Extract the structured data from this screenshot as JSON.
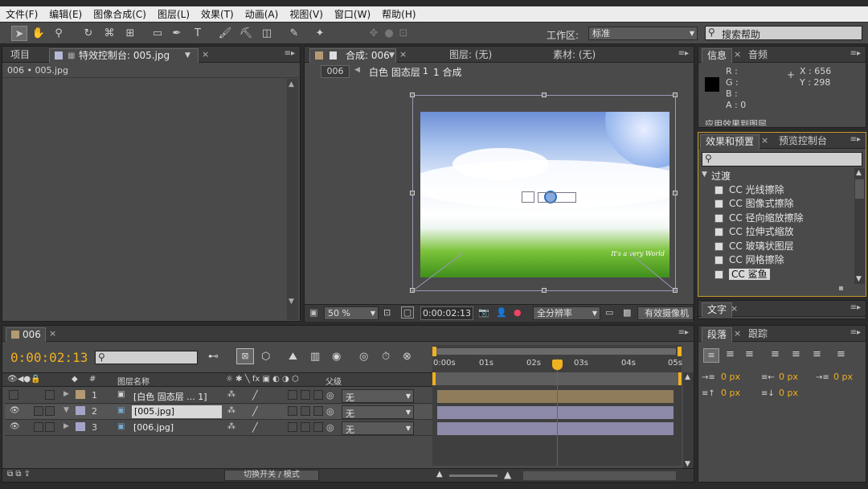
{
  "menu": [
    "文件(F)",
    "编辑(E)",
    "图像合成(C)",
    "图层(L)",
    "效果(T)",
    "动画(A)",
    "视图(V)",
    "窗口(W)",
    "帮助(H)"
  ],
  "toolbar": {
    "workspace_label": "工作区:",
    "workspace_value": "标准",
    "search_placeholder": "搜索帮助"
  },
  "project": {
    "tab_project": "项目",
    "tab_effects": "特效控制台: 005.jpg",
    "header": "006 • 005.jpg"
  },
  "comp": {
    "tab_comp": "合成: 006",
    "tab_layer": "图层: (无)",
    "tab_footage": "素材: (无)",
    "comp_name": "006",
    "breadcrumb_white": "白色 固态层",
    "breadcrumb_1": "1 合成",
    "breadcrumb_2": "1",
    "zoom": "50 %",
    "timecode": "0:00:02:13",
    "resolution": "全分辨率",
    "camera": "有效摄像机",
    "watermark": "It's a very World"
  },
  "info": {
    "tab_info": "信息",
    "tab_audio": "音频",
    "r": "R :",
    "g": "G :",
    "b": "B :",
    "a": "A : 0",
    "x": "X : 656",
    "y": "Y : 298",
    "clip": "应用效果到图层"
  },
  "effects": {
    "tab_effects": "效果和预置",
    "tab_preview": "预览控制台",
    "category": "过渡",
    "items": [
      "CC 光线擦除",
      "CC 图像式擦除",
      "CC 径向缩放擦除",
      "CC 拉伸式缩放",
      "CC 玻璃状图层",
      "CC 网格擦除",
      "CC 鲨鱼"
    ]
  },
  "text": {
    "tab": "文字"
  },
  "paragraph": {
    "tab_para": "段落",
    "tab_track": "跟踪",
    "v1": "0 px",
    "v2": "0 px",
    "v3": "0 px",
    "v4": "0 px",
    "v5": "0 px"
  },
  "timeline": {
    "tab": "006",
    "timecode": "0:00:02:13",
    "col_num": "#",
    "col_name": "图层名称",
    "col_parent": "父级",
    "ruler": [
      "0:00s",
      "01s",
      "02s",
      "03s",
      "04s",
      "05s"
    ],
    "toggle_label": "切换开关 / 模式",
    "layers": [
      {
        "num": "1",
        "name": "[白色 固态层 ... 1]",
        "parent": "无",
        "color": "#b49a72"
      },
      {
        "num": "2",
        "name": "[005.jpg]",
        "parent": "无",
        "color": "#a5a4c8"
      },
      {
        "num": "3",
        "name": "[006.jpg]",
        "parent": "无",
        "color": "#a5a4c8"
      }
    ]
  },
  "colors": {
    "accent": "#f0b020",
    "playhead": "#e03030"
  }
}
